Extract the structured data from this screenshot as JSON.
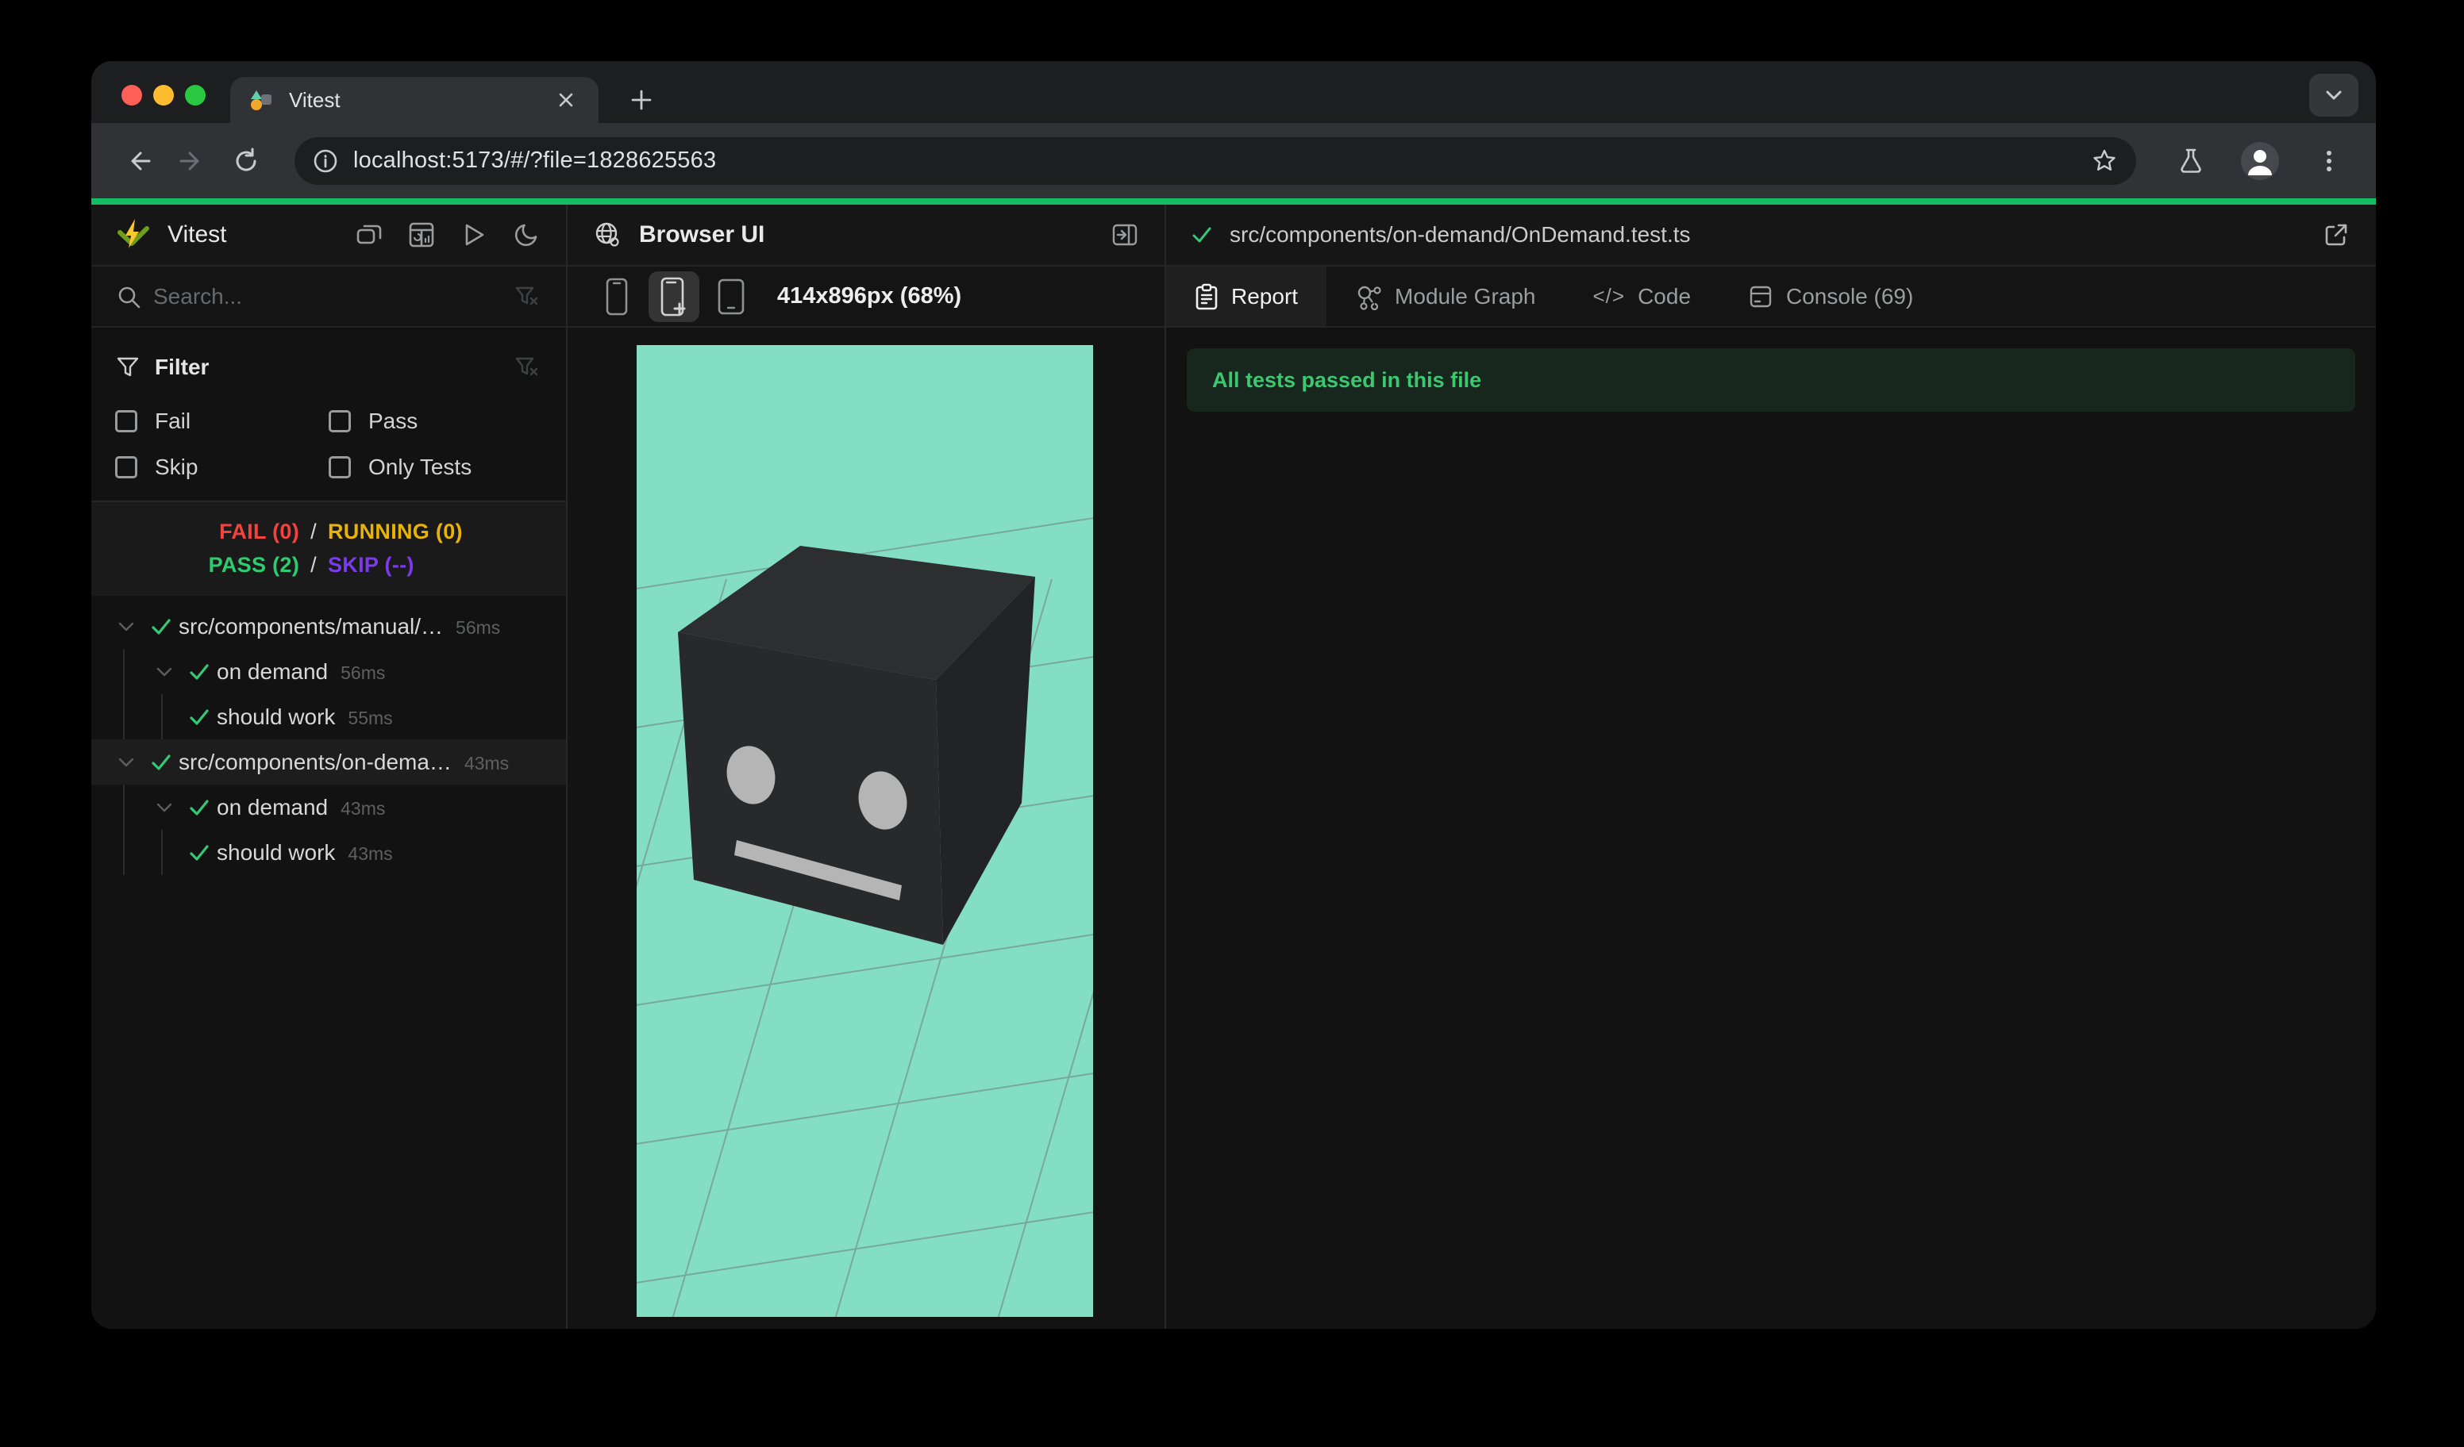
{
  "browser": {
    "tab_title": "Vitest",
    "url": "localhost:5173/#/?file=1828625563"
  },
  "colors": {
    "progress_green": "#14bd61",
    "pass_green": "#2ecc71",
    "fail_red": "#f4433e",
    "running_yellow": "#e9b306",
    "skip_purple": "#7c3aed",
    "banner_bg": "#17271d",
    "banner_text": "#3dc770",
    "scene_background": "#84dec3"
  },
  "sidebar": {
    "title": "Vitest",
    "search_placeholder": "Search...",
    "filter": {
      "label": "Filter",
      "options": [
        {
          "label": "Fail",
          "checked": false
        },
        {
          "label": "Pass",
          "checked": false
        },
        {
          "label": "Skip",
          "checked": false
        },
        {
          "label": "Only Tests",
          "checked": false
        }
      ]
    },
    "stats": {
      "fail": "FAIL (0)",
      "running": "RUNNING (0)",
      "pass": "PASS (2)",
      "skip": "SKIP (--)",
      "separator": "/"
    },
    "tree": [
      {
        "label": "src/components/manual/…",
        "duration": "56ms",
        "level": 0,
        "status": "pass",
        "active": false
      },
      {
        "label": "on demand",
        "duration": "56ms",
        "level": 1,
        "status": "pass",
        "active": false
      },
      {
        "label": "should work",
        "duration": "55ms",
        "level": 2,
        "status": "pass",
        "active": false
      },
      {
        "label": "src/components/on-dema…",
        "duration": "43ms",
        "level": 0,
        "status": "pass",
        "active": true
      },
      {
        "label": "on demand",
        "duration": "43ms",
        "level": 1,
        "status": "pass",
        "active": false
      },
      {
        "label": "should work",
        "duration": "43ms",
        "level": 2,
        "status": "pass",
        "active": false
      }
    ]
  },
  "preview": {
    "title": "Browser UI",
    "viewport": "414x896px (68%)"
  },
  "results": {
    "file_path": "src/components/on-demand/OnDemand.test.ts",
    "tabs": [
      {
        "label": "Report",
        "active": true
      },
      {
        "label": "Module Graph",
        "active": false
      },
      {
        "label": "Code",
        "active": false
      },
      {
        "label": "Console (69)",
        "active": false
      }
    ],
    "banner": "All tests passed in this file"
  }
}
